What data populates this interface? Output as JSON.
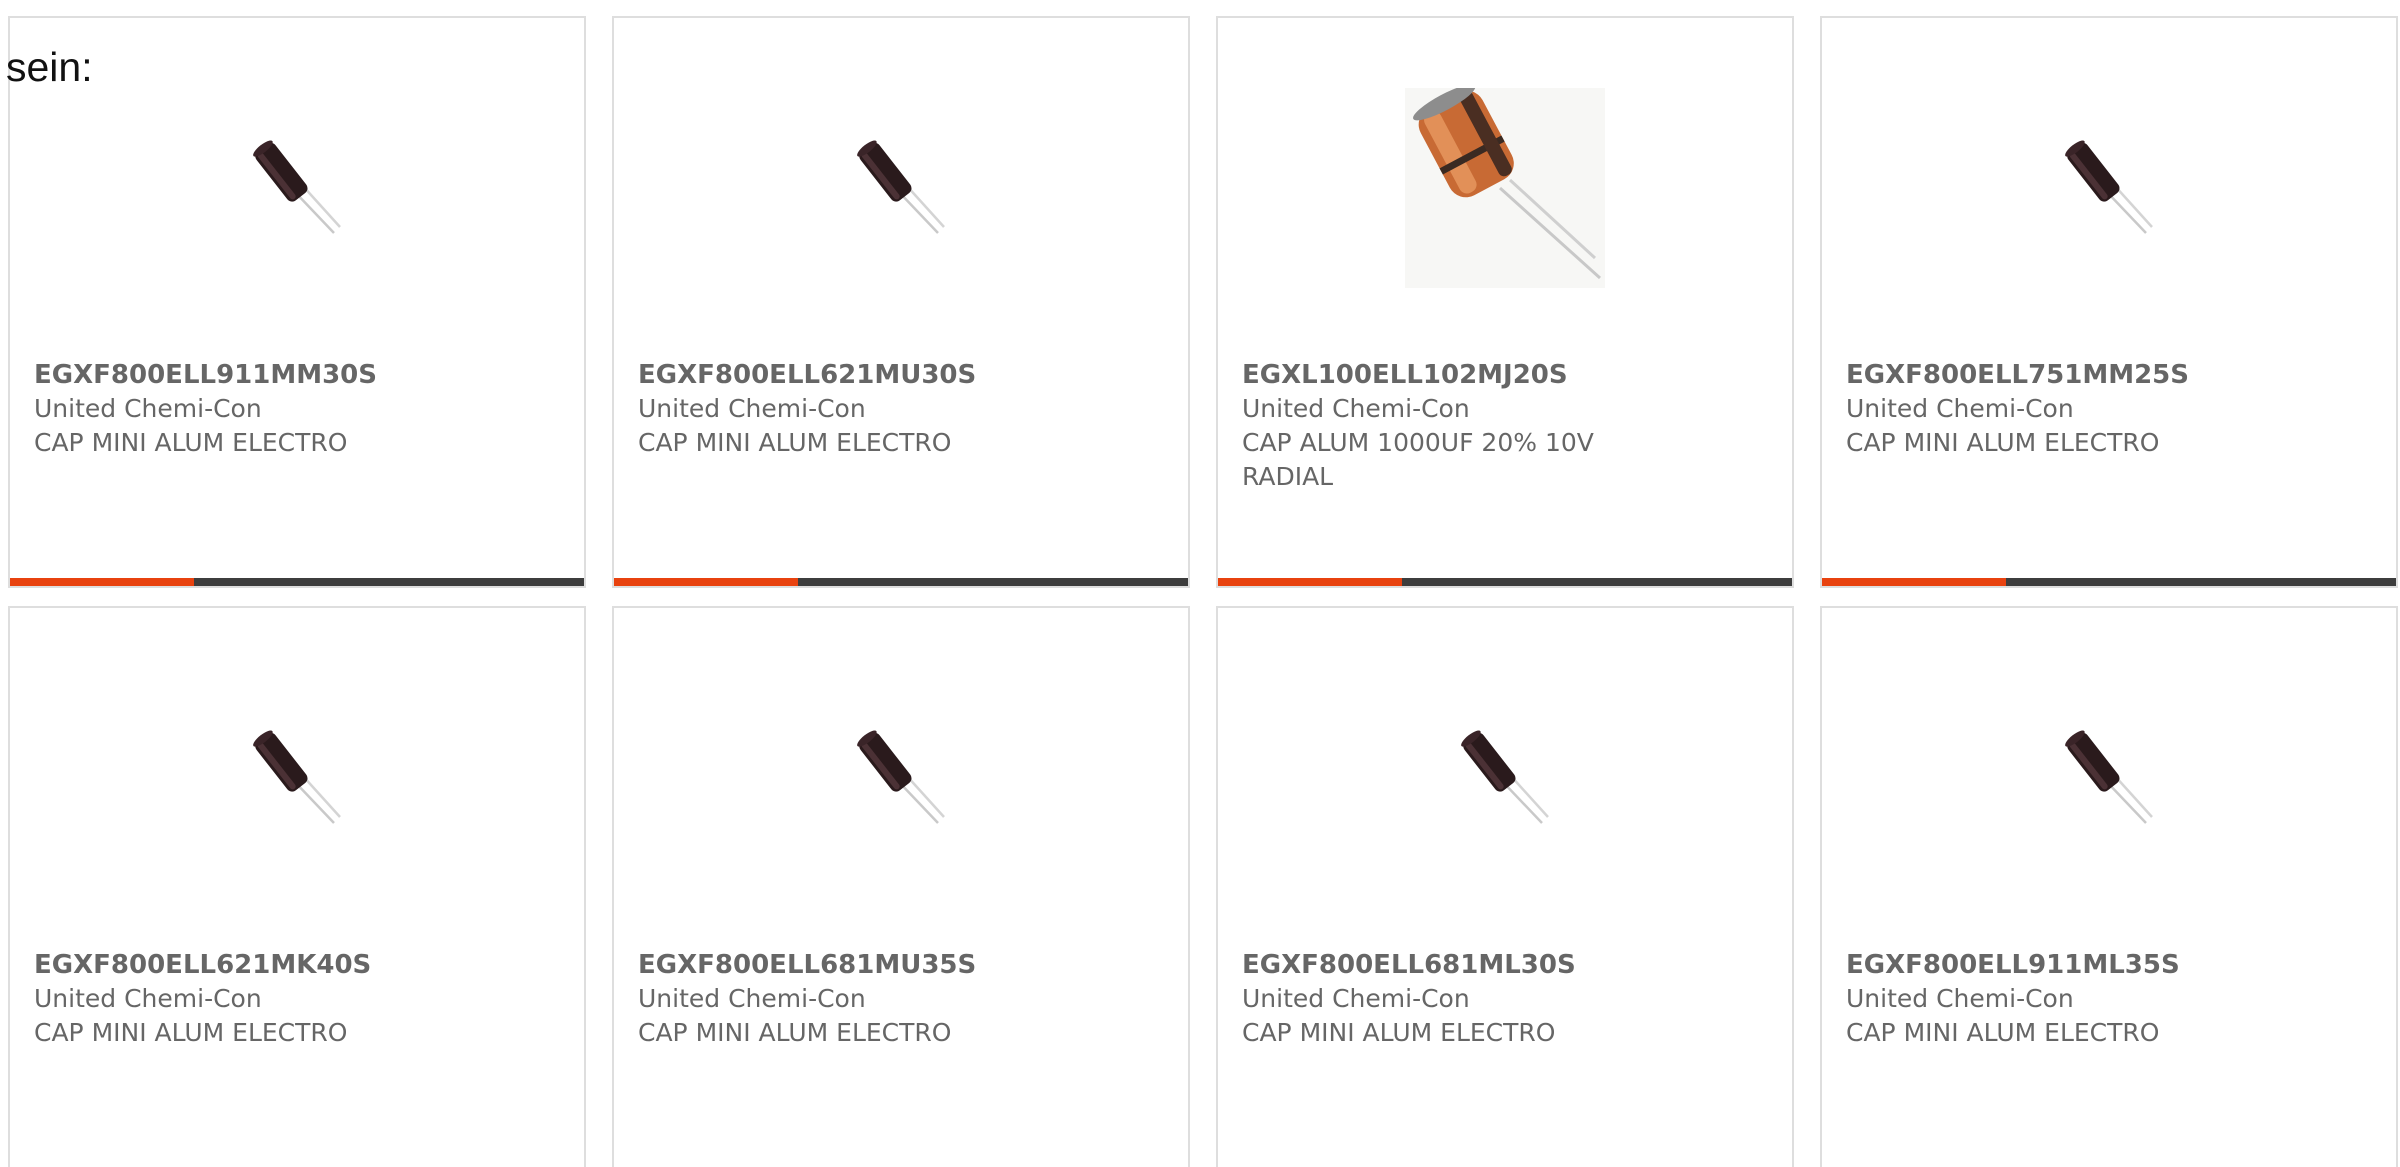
{
  "intro_text": "sein:",
  "colors": {
    "accent": "#e8420f",
    "bar_track": "#3d3d3d",
    "card_border": "#dedede",
    "text": "#666666"
  },
  "products": [
    {
      "part_number": "EGXF800ELL911MM30S",
      "manufacturer": "United Chemi-Con",
      "description": "CAP MINI ALUM ELECTRO",
      "image": "small-black-capacitor-icon",
      "highlight_fraction": 0.32
    },
    {
      "part_number": "EGXF800ELL621MU30S",
      "manufacturer": "United Chemi-Con",
      "description": "CAP MINI ALUM ELECTRO",
      "image": "small-black-capacitor-icon",
      "highlight_fraction": 0.32
    },
    {
      "part_number": "EGXL100ELL102MJ20S",
      "manufacturer": "United Chemi-Con",
      "description": "CAP ALUM 1000UF 20% 10V RADIAL",
      "image": "large-orange-capacitor-icon",
      "highlight_fraction": 0.32
    },
    {
      "part_number": "EGXF800ELL751MM25S",
      "manufacturer": "United Chemi-Con",
      "description": "CAP MINI ALUM ELECTRO",
      "image": "small-black-capacitor-icon",
      "highlight_fraction": 0.32
    },
    {
      "part_number": "EGXF800ELL621MK40S",
      "manufacturer": "United Chemi-Con",
      "description": "CAP MINI ALUM ELECTRO",
      "image": "small-black-capacitor-icon",
      "highlight_fraction": null
    },
    {
      "part_number": "EGXF800ELL681MU35S",
      "manufacturer": "United Chemi-Con",
      "description": "CAP MINI ALUM ELECTRO",
      "image": "small-black-capacitor-icon",
      "highlight_fraction": null
    },
    {
      "part_number": "EGXF800ELL681ML30S",
      "manufacturer": "United Chemi-Con",
      "description": "CAP MINI ALUM ELECTRO",
      "image": "small-black-capacitor-icon",
      "highlight_fraction": null
    },
    {
      "part_number": "EGXF800ELL911ML35S",
      "manufacturer": "United Chemi-Con",
      "description": "CAP MINI ALUM ELECTRO",
      "image": "small-black-capacitor-icon",
      "highlight_fraction": null
    }
  ]
}
